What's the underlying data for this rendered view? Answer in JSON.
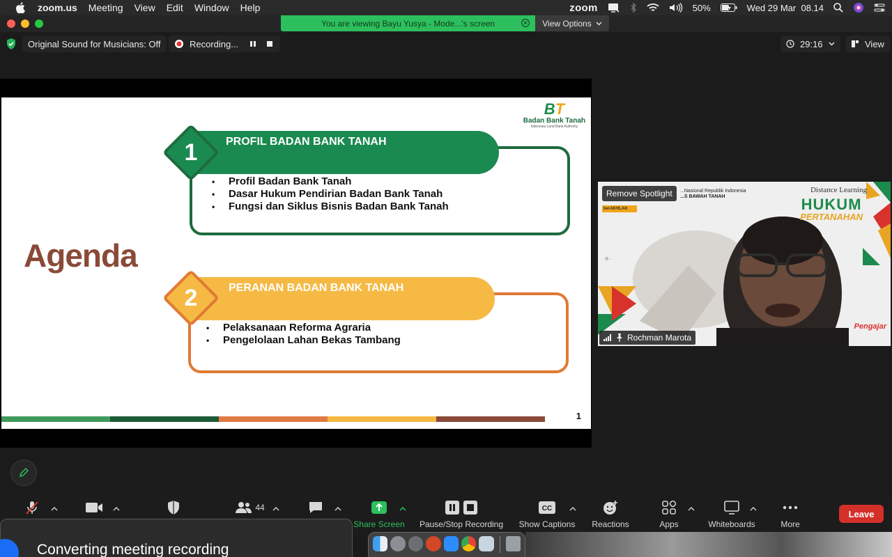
{
  "menubar": {
    "app_name": "zoom.us",
    "menus": [
      "Meeting",
      "View",
      "Edit",
      "Window",
      "Help"
    ],
    "zoom_logo": "zoom",
    "battery": "50%",
    "clock": "Wed 29 Mar  08.14",
    "icons": [
      "apple-icon",
      "zoom-screen-icon",
      "bluetooth-icon",
      "wifi-icon",
      "volume-icon",
      "battery-icon",
      "search-icon",
      "siri-icon",
      "control-center-icon"
    ]
  },
  "banner": {
    "viewing_text": "You are viewing Bayu Yusya - Mode...'s screen",
    "view_options": "View Options"
  },
  "status": {
    "original_sound": "Original Sound for Musicians: Off",
    "recording": "Recording...",
    "timer": "29:16",
    "view": "View"
  },
  "slide": {
    "logo_mark_b": "B",
    "logo_mark_t": "T",
    "logo_name": "Badan Bank Tanah",
    "logo_sub": "Indonesia Land Bank Authority",
    "agenda": "Agenda",
    "section1": {
      "number": "1",
      "title": "PROFIL BADAN BANK TANAH",
      "items": [
        "Profil Badan Bank Tanah",
        "Dasar Hukum Pendirian Badan Bank Tanah",
        "Fungsi dan Siklus Bisnis Badan Bank Tanah"
      ]
    },
    "section2": {
      "number": "2",
      "title": "PERANAN BADAN BANK TANAH",
      "items": [
        "Pelaksanaan Reforma Agraria",
        "Pengelolaan Lahan Bekas Tambang"
      ]
    },
    "page_number": "1"
  },
  "video": {
    "remove_spotlight": "Remove Spotlight",
    "participant_name": "Rochman Marota",
    "distance_learning": "Distance Learning",
    "hukum": "HUKUM",
    "pertanahan": "PERTANAHAN",
    "pengajar": "Pengajar",
    "org_line1": "...Nasional Republik Indonesia",
    "org_line2": "...S BAWAH TANAH",
    "berakhlak": "berAKHLAK"
  },
  "toolbar": {
    "participants_count": "44",
    "share_screen": "Share Screen",
    "pause_stop_recording": "Pause/Stop Recording",
    "show_captions": "Show Captions",
    "reactions": "Reactions",
    "apps": "Apps",
    "whiteboards": "Whiteboards",
    "more": "More",
    "leave": "Leave"
  },
  "notification": {
    "text": "Converting meeting recording"
  },
  "colors": {
    "green": "#1b8a50",
    "dark_green": "#1d6b3e",
    "yellow": "#f5b944",
    "orange": "#e07a34",
    "brown": "#8a4a38",
    "leave_red": "#d4302a",
    "share_green": "#2dbf5d"
  }
}
